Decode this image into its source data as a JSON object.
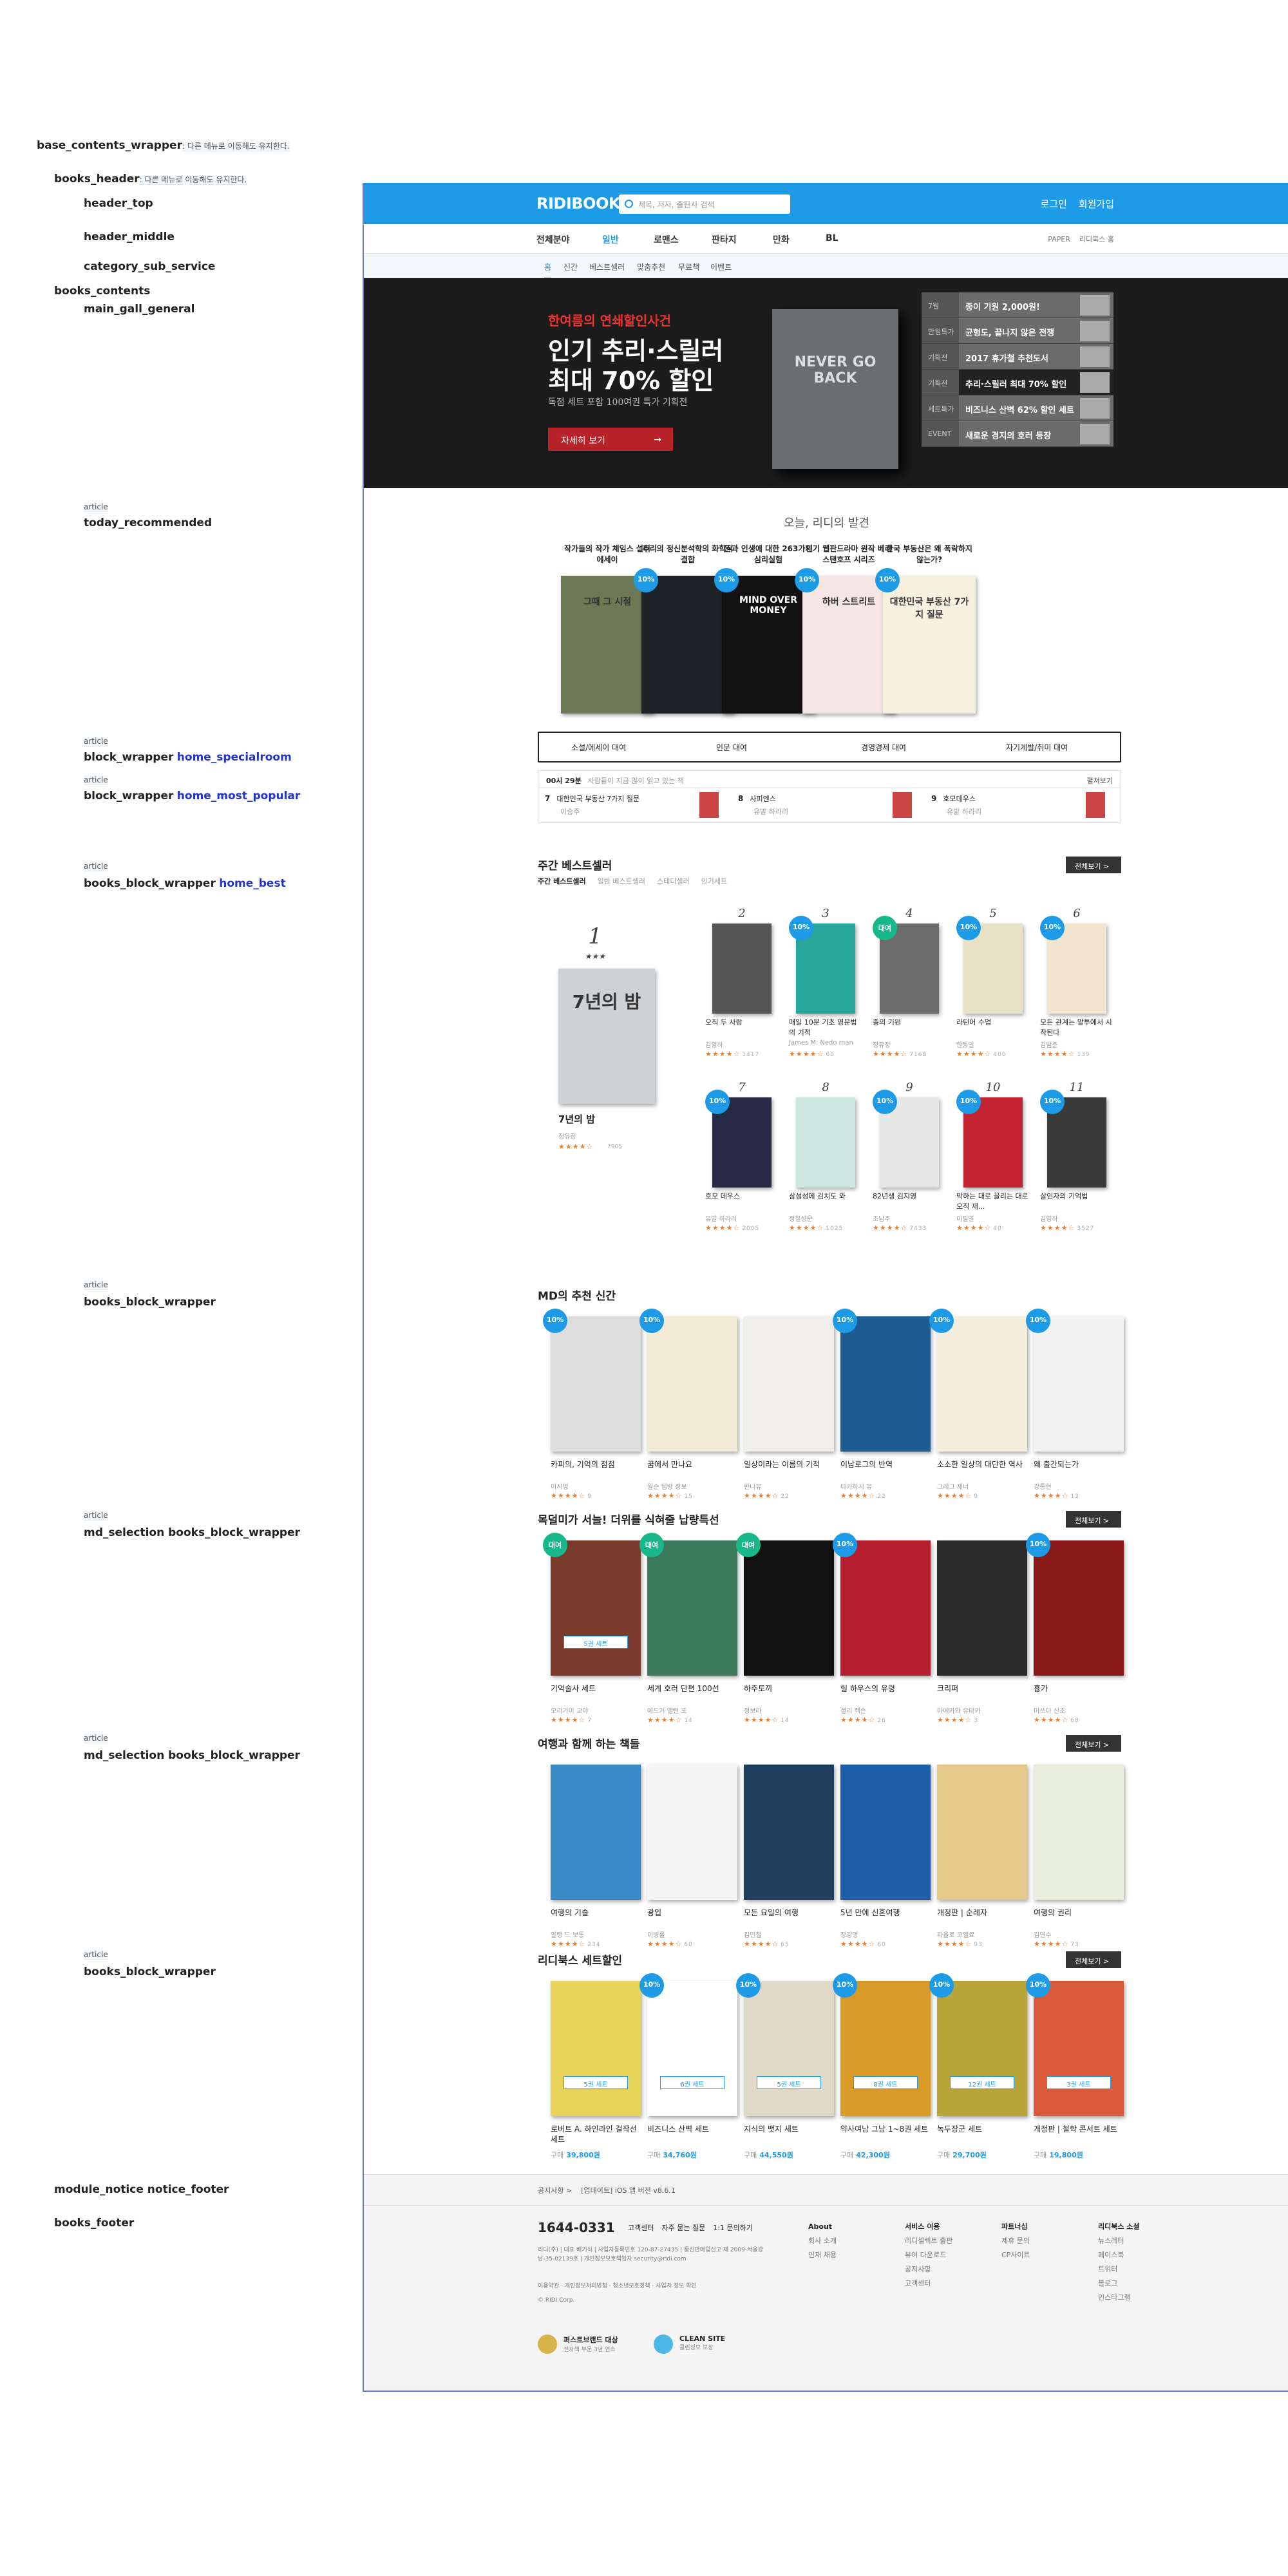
{
  "annotations": {
    "base_wrapper": "base_contents_wrapper",
    "base_wrapper_note": ": 다른 메뉴로 이동해도 유지한다.",
    "books_header": "books_header",
    "books_header_note": ": 다른 메뉴로 이동해도 유지한다.",
    "header_top": "header_top",
    "header_middle": "header_middle",
    "category_sub_service": "category_sub_service",
    "books_contents": "books_contents",
    "main_gall_general": "main_gall_general",
    "article": "article",
    "today_recommended": "today_recommended",
    "block_wrapper": "block_wrapper",
    "home_specialroom": "home_specialroom",
    "home_most_popular": "home_most_popular",
    "books_block_wrapper": "books_block_wrapper",
    "home_best": "home_best",
    "md_selection": "md_selection books_block_wrapper",
    "module_notice": "module_notice notice_footer",
    "books_footer": "books_footer"
  },
  "header": {
    "logo": "RIDIBOOKS",
    "search_placeholder": "제목, 저자, 출판사 검색",
    "login": "로그인",
    "signup": "회원가입"
  },
  "nav": {
    "items": [
      "전체분야",
      "일반",
      "로맨스",
      "판타지",
      "만화",
      "BL"
    ],
    "right": [
      "PAPER",
      "리디북스 홈"
    ]
  },
  "subnav": {
    "items": [
      "홈",
      "신간",
      "베스트셀러",
      "맞춤추천",
      "무료책",
      "이벤트"
    ]
  },
  "banner": {
    "eyebrow": "한여름의 연쇄할인사건",
    "title1": "인기 추리·스릴러",
    "title2": "최대 70% 할인",
    "desc": "독점 세트 포함 100여권 특가 기획전",
    "button": "자세히 보기",
    "book": "NEVER GO BACK",
    "list": [
      {
        "label": "7월",
        "text": "종이 기원 2,000원!"
      },
      {
        "label": "만원특가",
        "text": "균형도, 끝나지 않은 전쟁"
      },
      {
        "label": "기획전",
        "text": "2017 휴가철 추천도서"
      },
      {
        "label": "기획전",
        "text": "추리·스릴러 최대 70% 할인"
      },
      {
        "label": "세트특가",
        "text": "비즈니스 산벽 62% 할인 세트"
      },
      {
        "label": "EVENT",
        "text": "새로운 경지의 호러 등장"
      }
    ]
  },
  "today": {
    "title": "오늘, 리디의 발견",
    "items": [
      {
        "caption": "작가들의 작가 체임스 설터 에세이",
        "cover": "그때 그 시절",
        "color": "#6b7a55",
        "disc": ""
      },
      {
        "caption": "추리의 정신분석학의 화학적 결합",
        "cover": "",
        "color": "#1b2228",
        "disc": "10%"
      },
      {
        "caption": "돈과 인생에 대한 263가지 심리실험",
        "cover": "MIND OVER MONEY",
        "color": "#111",
        "disc": "10%"
      },
      {
        "caption": "인기 웹판드라마 원작 베라 스탠호프 시리즈",
        "cover": "하버 스트리트",
        "color": "#f4e6e3",
        "disc": "10%"
      },
      {
        "caption": "한국 부동산은 왜 폭락하지 않는가?",
        "cover": "대한민국 부동산 7가지 질문",
        "color": "#f6f0e0",
        "disc": "10%"
      }
    ]
  },
  "specials": [
    "소설/에세이 대여",
    "인문 대여",
    "경영경제 대여",
    "자기계발/취미 대여"
  ],
  "popular": {
    "head": "00시 29분",
    "note": "사람들이 지금 많이 읽고 있는 책",
    "link": "펼쳐보기",
    "items": [
      {
        "rank": "7",
        "title": "대한민국 부동산 7가지 질문",
        "author": "이승주"
      },
      {
        "rank": "8",
        "title": "사피엔스",
        "author": "유발 하라리"
      },
      {
        "rank": "9",
        "title": "호모데우스",
        "author": "유발 하라리"
      }
    ]
  },
  "best": {
    "title": "주간 베스트셀러",
    "more": "전체보기 >",
    "tabs": [
      "주간 베스트셀러",
      "일반 베스트셀러",
      "스테디셀러",
      "인기세트"
    ],
    "first": {
      "rank": "1",
      "stars": "★★★",
      "title": "7년의 밤",
      "author": "정유정",
      "rating": "★★★★☆",
      "count": "7905",
      "cover": "7년의 밤"
    },
    "items": [
      {
        "rank": "2",
        "title": "오직 두 사람",
        "author": "김영하",
        "count": "1417",
        "disc": "",
        "color": "#555"
      },
      {
        "rank": "3",
        "title": "매일 10분 기초 영문법의 기적",
        "author": "James M. Nedo man",
        "count": "60",
        "disc": "10%",
        "color": "#28a79c"
      },
      {
        "rank": "4",
        "title": "종의 기원",
        "author": "정유정",
        "count": "7168",
        "disc": "대여",
        "color": "#6c6c6c"
      },
      {
        "rank": "5",
        "title": "라틴어 수업",
        "author": "한동일",
        "count": "400",
        "disc": "10%",
        "color": "#e8e1c6"
      },
      {
        "rank": "6",
        "title": "모든 관계는 말투에서 시작된다",
        "author": "김범준",
        "count": "139",
        "disc": "10%",
        "color": "#f2e5d0"
      },
      {
        "rank": "7",
        "title": "호모 데우스",
        "author": "유발 하라리",
        "count": "2005",
        "disc": "10%",
        "color": "#262a44"
      },
      {
        "rank": "8",
        "title": "삼성성에 김치도 와",
        "author": "정철성운",
        "count": "1025",
        "disc": "",
        "color": "#cce6e0"
      },
      {
        "rank": "9",
        "title": "82년생 김지영",
        "author": "조남주",
        "count": "7433",
        "disc": "10%",
        "color": "#e7e7e7"
      },
      {
        "rank": "10",
        "title": "막하는 대로 끌리는 대로 오직 재...",
        "author": "이필연",
        "count": "40",
        "disc": "10%",
        "color": "#c22531"
      },
      {
        "rank": "11",
        "title": "살인자의 기억법",
        "author": "김영하",
        "count": "3527",
        "disc": "10%",
        "color": "#3a3a3a"
      }
    ]
  },
  "md": {
    "title": "MD의 추천 신간",
    "items": [
      {
        "title": "카피의, 기억의 점점",
        "author": "이시영",
        "count": "9",
        "disc": "10%",
        "color": "#dedede"
      },
      {
        "title": "꿈에서 만나요",
        "author": "월슨 팀랑 정보",
        "count": "15",
        "disc": "10%",
        "color": "#f3ead5"
      },
      {
        "title": "일상이라는 이름의 기적",
        "author": "한나유",
        "count": "22",
        "disc": "",
        "color": "#f0eeea"
      },
      {
        "title": "이남로그의 반역",
        "author": "타카하시 유",
        "count": "22",
        "disc": "10%",
        "color": "#1e5c92"
      },
      {
        "title": "소소한 일상의 대단한 역사",
        "author": "그레그 제너",
        "count": "9",
        "disc": "10%",
        "color": "#f2eddc"
      },
      {
        "title": "왜 출간되는가",
        "author": "강통현",
        "count": "13",
        "disc": "10%",
        "color": "#f2f2f2"
      }
    ]
  },
  "theme1": {
    "title": "목덜미가 서늘! 더위를 식혀줄 납량특선",
    "more": "전체보기 >",
    "items": [
      {
        "title": "기억술사 세트",
        "author": "오리가미 교야",
        "count": "7",
        "disc": "대여",
        "color": "#7a3b2d",
        "set": "5권 세트"
      },
      {
        "title": "세계 호러 단편 100선",
        "author": "에드거 앨런 포",
        "count": "14",
        "disc": "대여",
        "color": "#3b7a5a",
        "set": ""
      },
      {
        "title": "하주토끼",
        "author": "정보라",
        "count": "14",
        "disc": "대여",
        "color": "#111",
        "set": ""
      },
      {
        "title": "릴 하우스의 유령",
        "author": "셜리 잭슨",
        "count": "26",
        "disc": "10%",
        "color": "#b51e2e",
        "set": ""
      },
      {
        "title": "크리퍼",
        "author": "마에카와 유타카",
        "count": "3",
        "disc": "",
        "color": "#2a2a2a",
        "set": ""
      },
      {
        "title": "흉가",
        "author": "미쓰다 신조",
        "count": "68",
        "disc": "10%",
        "color": "#8a1a1a",
        "set": ""
      }
    ]
  },
  "theme2": {
    "title": "여행과 함께 하는 책들",
    "more": "전체보기 >",
    "items": [
      {
        "title": "여행의 기술",
        "author": "알랭 드 보통",
        "count": "234",
        "color": "#3a8bc5"
      },
      {
        "title": "광입",
        "author": "이병률",
        "count": "60",
        "color": "#f5f5f5"
      },
      {
        "title": "모든 요일의 여행",
        "author": "김민철",
        "count": "65",
        "color": "#1f3d5c"
      },
      {
        "title": "5년 만에 신혼여행",
        "author": "장강명",
        "count": "60",
        "color": "#1c5fa8"
      },
      {
        "title": "개정판 | 순례자",
        "author": "파울로 코엘료",
        "count": "93",
        "color": "#e6c88a"
      },
      {
        "title": "여행의 권리",
        "author": "김연수",
        "count": "73",
        "color": "#e9eddd"
      }
    ]
  },
  "sets": {
    "title": "리디북스 세트할인",
    "more": "전체보기 >",
    "items": [
      {
        "title": "로버트 A. 하인라인 걸작선 세트",
        "price": "39,800원",
        "set": "5권 세트",
        "disc": "",
        "color": "#e8d35a"
      },
      {
        "title": "비즈니스 산벽 세트",
        "price": "34,760원",
        "set": "6권 세트",
        "disc": "10%",
        "color": "#ffffff"
      },
      {
        "title": "지식의 뱃지 세트",
        "price": "44,550원",
        "set": "5권 세트",
        "disc": "10%",
        "color": "#e0d9c8"
      },
      {
        "title": "약사여남 그남 1~8권 세트",
        "price": "42,300원",
        "set": "8권 세트",
        "disc": "10%",
        "color": "#d99b28"
      },
      {
        "title": "녹두장군 세트",
        "price": "29,700원",
        "set": "12권 세트",
        "disc": "10%",
        "color": "#b7a53a"
      },
      {
        "title": "개정판 | 철학 콘서트 세트",
        "price": "19,800원",
        "set": "3권 세트",
        "disc": "10%",
        "color": "#d95a3a"
      }
    ]
  },
  "notice": {
    "label": "공지사항 >",
    "text": "[업데이트] iOS 앱 버전 v8.6.1"
  },
  "footer": {
    "phone": "1644-0331",
    "links": [
      "고객센터",
      "자주 묻는 질문",
      "1:1 문의하기"
    ],
    "info": "리디(주) | 대표 배기식 | 사업자등록번호 120-87-27435 | 통신판매업신고 제 2009-서울강남-35-02139호 | 개인정보보호책임자 security@ridi.com",
    "policy": "이용약관 · 개인정보처리방침 · 청소년보호정책 · 사업자 정보 확인",
    "copy": "© RIDI Corp.",
    "cols": [
      {
        "head": "About",
        "items": [
          "회사 소개",
          "인재 채용"
        ]
      },
      {
        "head": "서비스 이용",
        "items": [
          "리디셀렉트 출판",
          "뷰어 다운로드",
          "공지사항",
          "고객센터"
        ]
      },
      {
        "head": "파트너십",
        "items": [
          "제휴 문의",
          "CP사이트"
        ]
      },
      {
        "head": "리디북스 소셜",
        "items": [
          "뉴스레터",
          "페이스북",
          "트위터",
          "블로그",
          "인스타그램"
        ]
      }
    ],
    "badge1": "퍼스트브랜드 대상",
    "badge1_sub": "전자책 부문 3년 연속",
    "badge2": "CLEAN SITE",
    "badge2_sub": "클린정보 보장"
  },
  "colors": {
    "brand": "#1e9be6",
    "dark": "#222222",
    "discount": "#1e9be6",
    "rent": "#19b88a",
    "star": "#f47b20"
  }
}
